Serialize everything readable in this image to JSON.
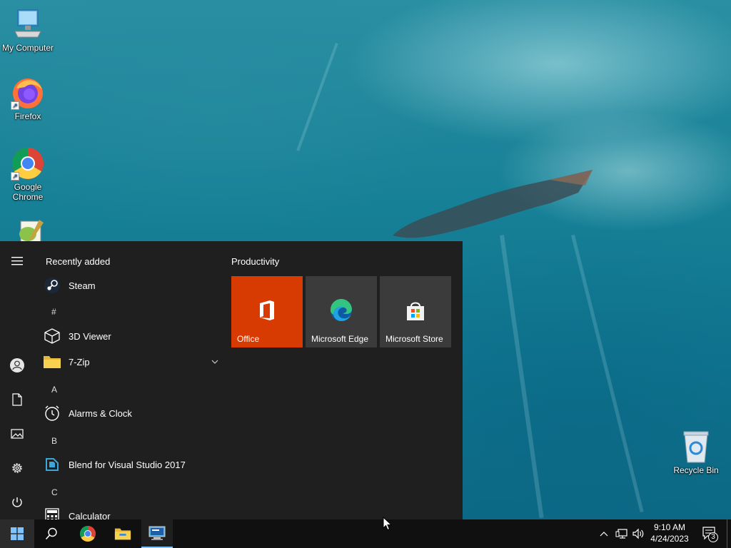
{
  "desktop": {
    "icons": [
      {
        "label": "My Computer"
      },
      {
        "label": "Firefox"
      },
      {
        "label": "Google Chrome"
      },
      {
        "label": ""
      },
      {
        "label": "Recycle Bin"
      }
    ]
  },
  "start_menu": {
    "rail": [
      "menu-icon",
      "user-icon",
      "documents-icon",
      "pictures-icon",
      "settings-icon",
      "power-icon"
    ],
    "recently_added_header": "Recently added",
    "apps": {
      "steam": "Steam",
      "hash": "#",
      "viewer3d": "3D Viewer",
      "sevenzip": "7-Zip",
      "letter_a": "A",
      "alarms": "Alarms & Clock",
      "letter_b": "B",
      "blend": "Blend for Visual Studio 2017",
      "letter_c": "C",
      "calculator": "Calculator"
    },
    "tiles_group": "Productivity",
    "tiles": {
      "office": "Office",
      "edge": "Microsoft Edge",
      "store": "Microsoft Store"
    },
    "colors": {
      "office_tile": "#d83b01",
      "tile_bg": "#3b3b3b",
      "menu_bg": "#1f1f1f"
    }
  },
  "taskbar": {
    "clock_time": "9:10 AM",
    "clock_date": "4/24/2023",
    "notification_count": "3"
  }
}
